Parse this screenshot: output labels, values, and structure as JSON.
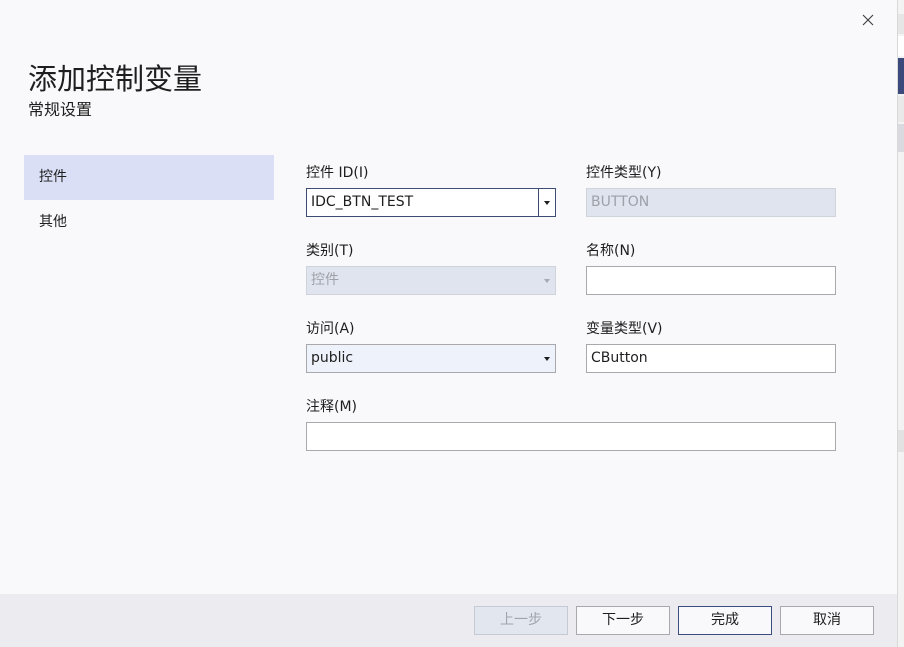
{
  "window": {
    "title": "添加控制变量",
    "subtitle": "常规设置",
    "close_icon": "close-icon"
  },
  "nav": {
    "items": [
      {
        "label": "控件",
        "selected": true
      },
      {
        "label": "其他",
        "selected": false
      }
    ]
  },
  "form": {
    "control_id": {
      "label": "控件 ID(I)",
      "value": "IDC_BTN_TEST"
    },
    "control_type": {
      "label": "控件类型(Y)",
      "value": "BUTTON"
    },
    "category": {
      "label": "类别(T)",
      "value": "控件"
    },
    "name": {
      "label": "名称(N)",
      "value": ""
    },
    "access": {
      "label": "访问(A)",
      "value": "public"
    },
    "variable_type": {
      "label": "变量类型(V)",
      "value": "CButton"
    },
    "comment": {
      "label": "注释(M)",
      "value": ""
    }
  },
  "footer": {
    "prev_label": "上一步",
    "next_label": "下一步",
    "finish_label": "完成",
    "cancel_label": "取消"
  },
  "colors": {
    "nav_selected": "#dadff6",
    "dialog_bg": "#f9f9fb",
    "footer_bg": "#ececf0",
    "focus_border": "#3c4c73"
  }
}
